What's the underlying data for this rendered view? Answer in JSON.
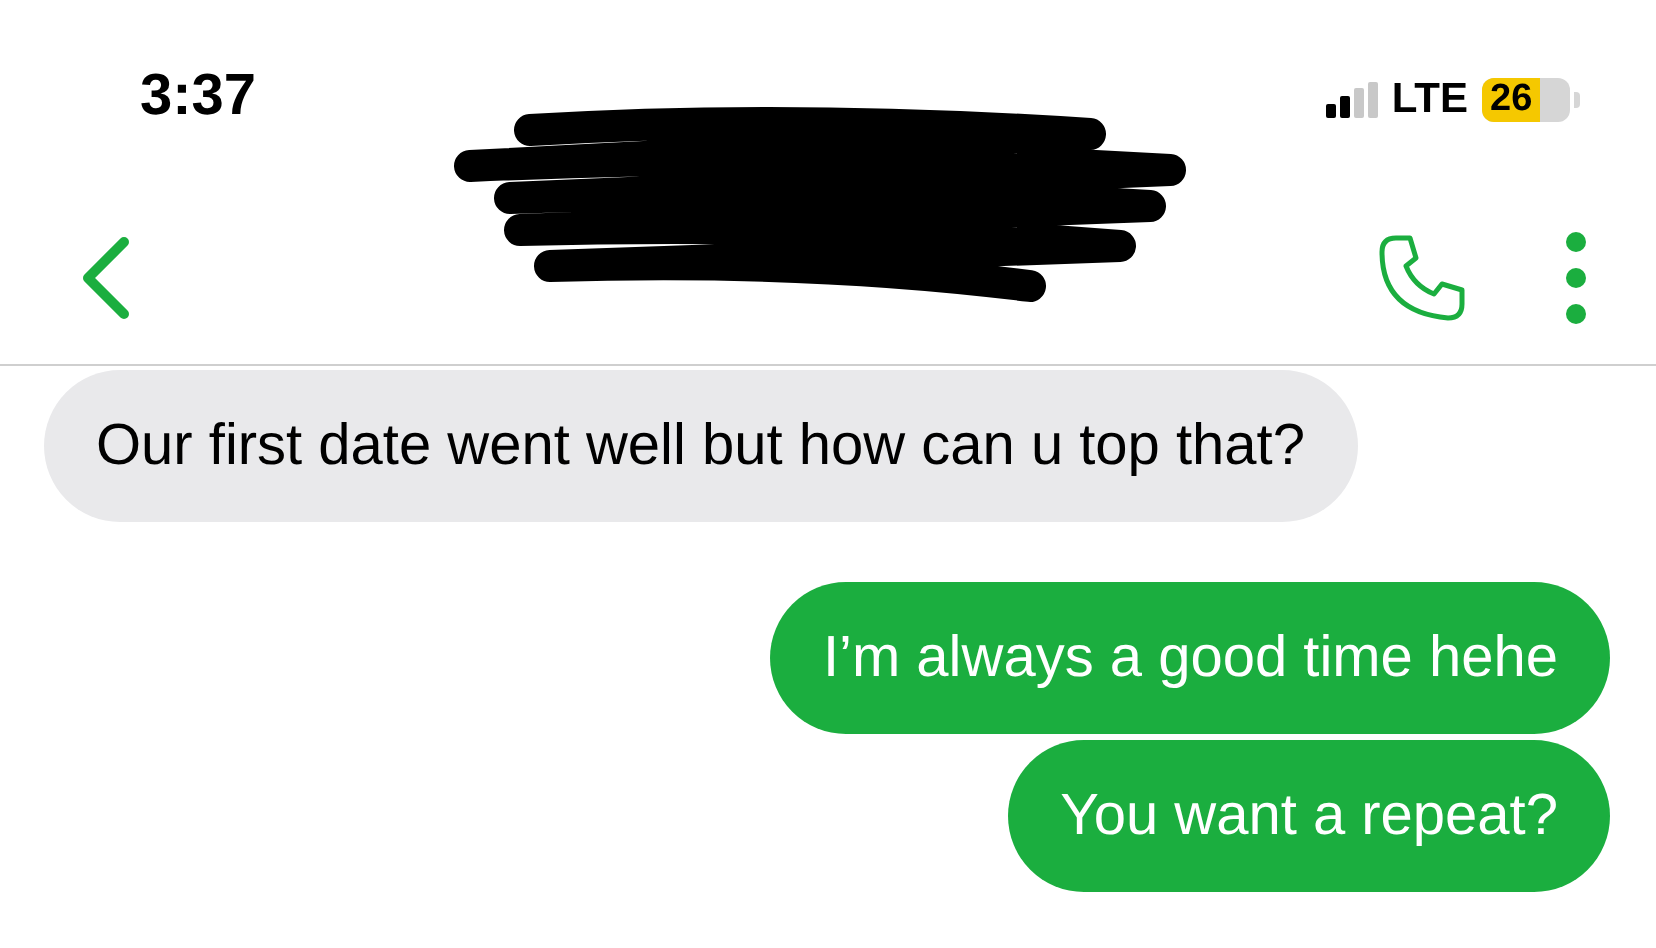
{
  "status_bar": {
    "time": "3:37",
    "network": "LTE",
    "battery": "26"
  },
  "header": {
    "contact_redacted": true
  },
  "messages": [
    {
      "kind": "incoming",
      "text": "Our first date went well but how can u top that?"
    },
    {
      "kind": "outgoing",
      "text": "I’m always a good time hehe"
    },
    {
      "kind": "outgoing",
      "text": "You want a repeat?"
    }
  ]
}
